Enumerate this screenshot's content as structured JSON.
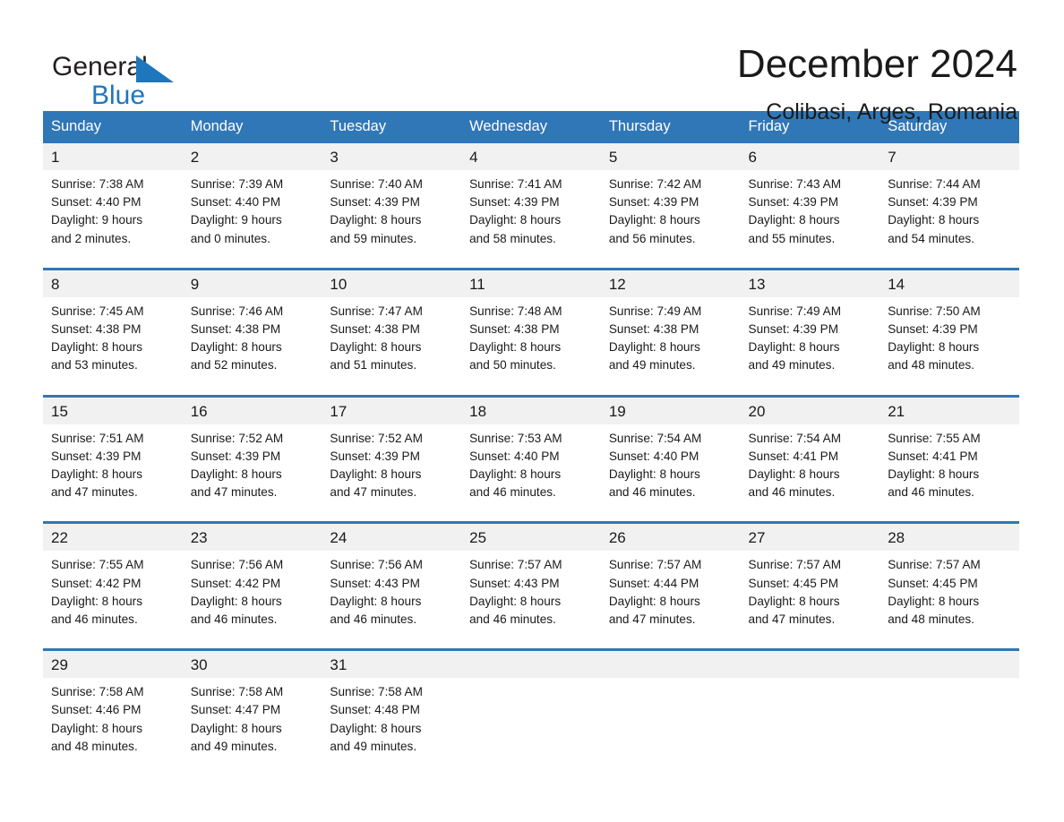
{
  "brand": {
    "word_one": "General",
    "word_two": "Blue",
    "triangle_icon": "blue-triangle-logo",
    "accent_color": "#1e76bd"
  },
  "header": {
    "title": "December 2024",
    "subtitle": "Colibasi, Arges, Romania"
  },
  "theme": {
    "header_blue": "#3077b7",
    "date_band_gray": "#f1f1f1",
    "text_color": "#1a1a1a"
  },
  "calendar": {
    "day_headers": [
      "Sunday",
      "Monday",
      "Tuesday",
      "Wednesday",
      "Thursday",
      "Friday",
      "Saturday"
    ],
    "weeks": [
      {
        "dates": [
          "1",
          "2",
          "3",
          "4",
          "5",
          "6",
          "7"
        ],
        "cells": [
          {
            "sunrise": "Sunrise: 7:38 AM",
            "sunset": "Sunset: 4:40 PM",
            "daylight_1": "Daylight: 9 hours",
            "daylight_2": "and 2 minutes."
          },
          {
            "sunrise": "Sunrise: 7:39 AM",
            "sunset": "Sunset: 4:40 PM",
            "daylight_1": "Daylight: 9 hours",
            "daylight_2": "and 0 minutes."
          },
          {
            "sunrise": "Sunrise: 7:40 AM",
            "sunset": "Sunset: 4:39 PM",
            "daylight_1": "Daylight: 8 hours",
            "daylight_2": "and 59 minutes."
          },
          {
            "sunrise": "Sunrise: 7:41 AM",
            "sunset": "Sunset: 4:39 PM",
            "daylight_1": "Daylight: 8 hours",
            "daylight_2": "and 58 minutes."
          },
          {
            "sunrise": "Sunrise: 7:42 AM",
            "sunset": "Sunset: 4:39 PM",
            "daylight_1": "Daylight: 8 hours",
            "daylight_2": "and 56 minutes."
          },
          {
            "sunrise": "Sunrise: 7:43 AM",
            "sunset": "Sunset: 4:39 PM",
            "daylight_1": "Daylight: 8 hours",
            "daylight_2": "and 55 minutes."
          },
          {
            "sunrise": "Sunrise: 7:44 AM",
            "sunset": "Sunset: 4:39 PM",
            "daylight_1": "Daylight: 8 hours",
            "daylight_2": "and 54 minutes."
          }
        ]
      },
      {
        "dates": [
          "8",
          "9",
          "10",
          "11",
          "12",
          "13",
          "14"
        ],
        "cells": [
          {
            "sunrise": "Sunrise: 7:45 AM",
            "sunset": "Sunset: 4:38 PM",
            "daylight_1": "Daylight: 8 hours",
            "daylight_2": "and 53 minutes."
          },
          {
            "sunrise": "Sunrise: 7:46 AM",
            "sunset": "Sunset: 4:38 PM",
            "daylight_1": "Daylight: 8 hours",
            "daylight_2": "and 52 minutes."
          },
          {
            "sunrise": "Sunrise: 7:47 AM",
            "sunset": "Sunset: 4:38 PM",
            "daylight_1": "Daylight: 8 hours",
            "daylight_2": "and 51 minutes."
          },
          {
            "sunrise": "Sunrise: 7:48 AM",
            "sunset": "Sunset: 4:38 PM",
            "daylight_1": "Daylight: 8 hours",
            "daylight_2": "and 50 minutes."
          },
          {
            "sunrise": "Sunrise: 7:49 AM",
            "sunset": "Sunset: 4:38 PM",
            "daylight_1": "Daylight: 8 hours",
            "daylight_2": "and 49 minutes."
          },
          {
            "sunrise": "Sunrise: 7:49 AM",
            "sunset": "Sunset: 4:39 PM",
            "daylight_1": "Daylight: 8 hours",
            "daylight_2": "and 49 minutes."
          },
          {
            "sunrise": "Sunrise: 7:50 AM",
            "sunset": "Sunset: 4:39 PM",
            "daylight_1": "Daylight: 8 hours",
            "daylight_2": "and 48 minutes."
          }
        ]
      },
      {
        "dates": [
          "15",
          "16",
          "17",
          "18",
          "19",
          "20",
          "21"
        ],
        "cells": [
          {
            "sunrise": "Sunrise: 7:51 AM",
            "sunset": "Sunset: 4:39 PM",
            "daylight_1": "Daylight: 8 hours",
            "daylight_2": "and 47 minutes."
          },
          {
            "sunrise": "Sunrise: 7:52 AM",
            "sunset": "Sunset: 4:39 PM",
            "daylight_1": "Daylight: 8 hours",
            "daylight_2": "and 47 minutes."
          },
          {
            "sunrise": "Sunrise: 7:52 AM",
            "sunset": "Sunset: 4:39 PM",
            "daylight_1": "Daylight: 8 hours",
            "daylight_2": "and 47 minutes."
          },
          {
            "sunrise": "Sunrise: 7:53 AM",
            "sunset": "Sunset: 4:40 PM",
            "daylight_1": "Daylight: 8 hours",
            "daylight_2": "and 46 minutes."
          },
          {
            "sunrise": "Sunrise: 7:54 AM",
            "sunset": "Sunset: 4:40 PM",
            "daylight_1": "Daylight: 8 hours",
            "daylight_2": "and 46 minutes."
          },
          {
            "sunrise": "Sunrise: 7:54 AM",
            "sunset": "Sunset: 4:41 PM",
            "daylight_1": "Daylight: 8 hours",
            "daylight_2": "and 46 minutes."
          },
          {
            "sunrise": "Sunrise: 7:55 AM",
            "sunset": "Sunset: 4:41 PM",
            "daylight_1": "Daylight: 8 hours",
            "daylight_2": "and 46 minutes."
          }
        ]
      },
      {
        "dates": [
          "22",
          "23",
          "24",
          "25",
          "26",
          "27",
          "28"
        ],
        "cells": [
          {
            "sunrise": "Sunrise: 7:55 AM",
            "sunset": "Sunset: 4:42 PM",
            "daylight_1": "Daylight: 8 hours",
            "daylight_2": "and 46 minutes."
          },
          {
            "sunrise": "Sunrise: 7:56 AM",
            "sunset": "Sunset: 4:42 PM",
            "daylight_1": "Daylight: 8 hours",
            "daylight_2": "and 46 minutes."
          },
          {
            "sunrise": "Sunrise: 7:56 AM",
            "sunset": "Sunset: 4:43 PM",
            "daylight_1": "Daylight: 8 hours",
            "daylight_2": "and 46 minutes."
          },
          {
            "sunrise": "Sunrise: 7:57 AM",
            "sunset": "Sunset: 4:43 PM",
            "daylight_1": "Daylight: 8 hours",
            "daylight_2": "and 46 minutes."
          },
          {
            "sunrise": "Sunrise: 7:57 AM",
            "sunset": "Sunset: 4:44 PM",
            "daylight_1": "Daylight: 8 hours",
            "daylight_2": "and 47 minutes."
          },
          {
            "sunrise": "Sunrise: 7:57 AM",
            "sunset": "Sunset: 4:45 PM",
            "daylight_1": "Daylight: 8 hours",
            "daylight_2": "and 47 minutes."
          },
          {
            "sunrise": "Sunrise: 7:57 AM",
            "sunset": "Sunset: 4:45 PM",
            "daylight_1": "Daylight: 8 hours",
            "daylight_2": "and 48 minutes."
          }
        ]
      },
      {
        "dates": [
          "29",
          "30",
          "31",
          "",
          "",
          "",
          ""
        ],
        "cells": [
          {
            "sunrise": "Sunrise: 7:58 AM",
            "sunset": "Sunset: 4:46 PM",
            "daylight_1": "Daylight: 8 hours",
            "daylight_2": "and 48 minutes."
          },
          {
            "sunrise": "Sunrise: 7:58 AM",
            "sunset": "Sunset: 4:47 PM",
            "daylight_1": "Daylight: 8 hours",
            "daylight_2": "and 49 minutes."
          },
          {
            "sunrise": "Sunrise: 7:58 AM",
            "sunset": "Sunset: 4:48 PM",
            "daylight_1": "Daylight: 8 hours",
            "daylight_2": "and 49 minutes."
          },
          {
            "sunrise": "",
            "sunset": "",
            "daylight_1": "",
            "daylight_2": ""
          },
          {
            "sunrise": "",
            "sunset": "",
            "daylight_1": "",
            "daylight_2": ""
          },
          {
            "sunrise": "",
            "sunset": "",
            "daylight_1": "",
            "daylight_2": ""
          },
          {
            "sunrise": "",
            "sunset": "",
            "daylight_1": "",
            "daylight_2": ""
          }
        ]
      }
    ]
  }
}
